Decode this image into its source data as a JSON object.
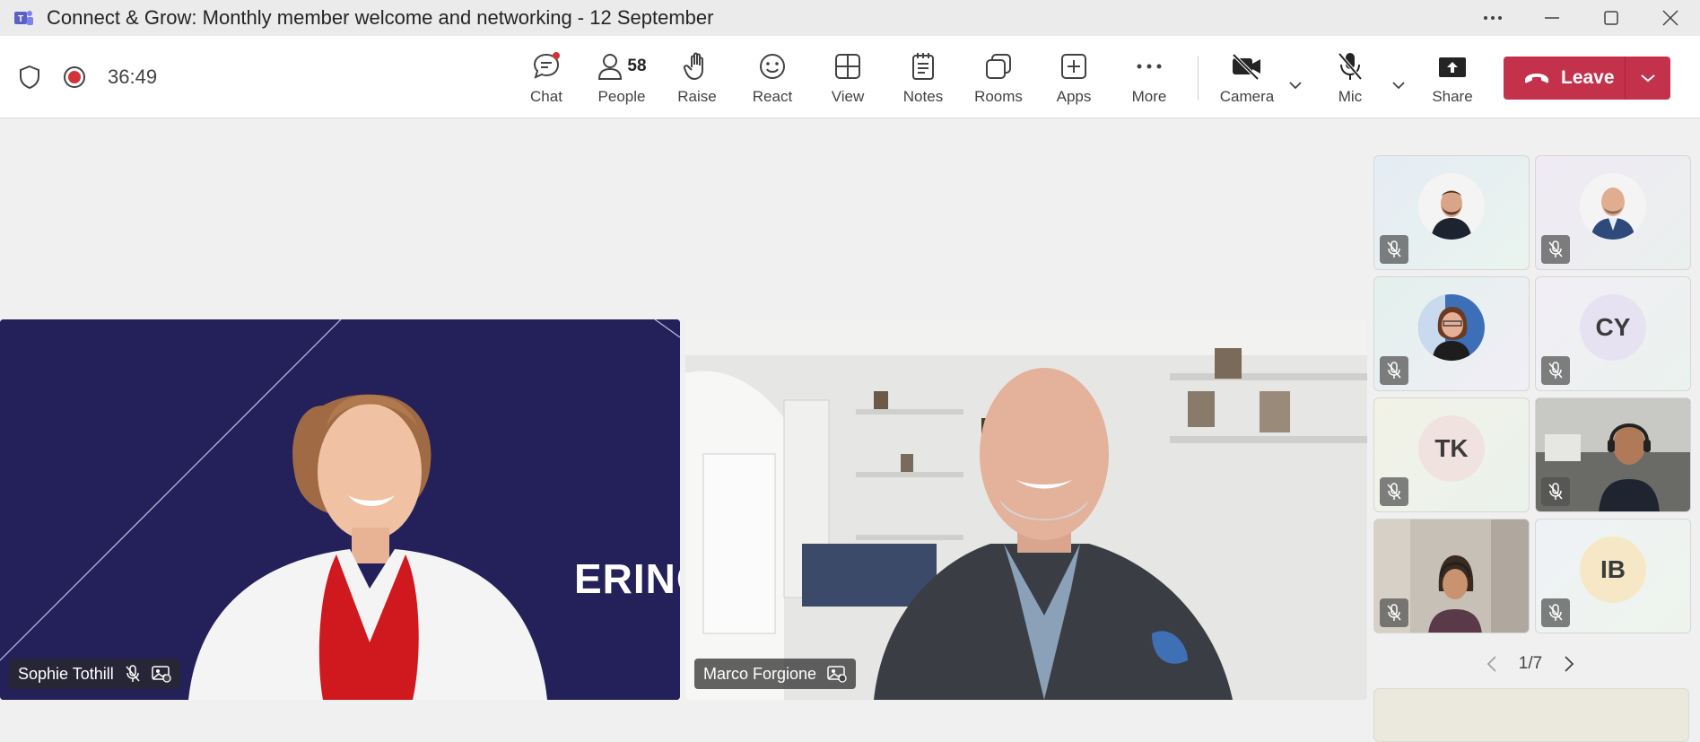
{
  "window": {
    "title": "Connect & Grow: Monthly member welcome and networking - 12 September"
  },
  "status": {
    "timer": "36:49"
  },
  "toolbar": {
    "chat": "Chat",
    "people": "People",
    "people_count": "58",
    "raise": "Raise",
    "react": "React",
    "view": "View",
    "notes": "Notes",
    "rooms": "Rooms",
    "apps": "Apps",
    "more": "More",
    "camera": "Camera",
    "mic": "Mic",
    "share": "Share",
    "leave": "Leave"
  },
  "main_tiles": [
    {
      "name": "Sophie Tothill",
      "background_text": "ERING C"
    },
    {
      "name": "Marco Forgione"
    }
  ],
  "gallery": {
    "initials": [
      "CY",
      "TK",
      "IB"
    ],
    "page": "1/7"
  },
  "colors": {
    "leave": "#c4314b",
    "brand": "#5b5fc7",
    "record": "#d13438"
  }
}
